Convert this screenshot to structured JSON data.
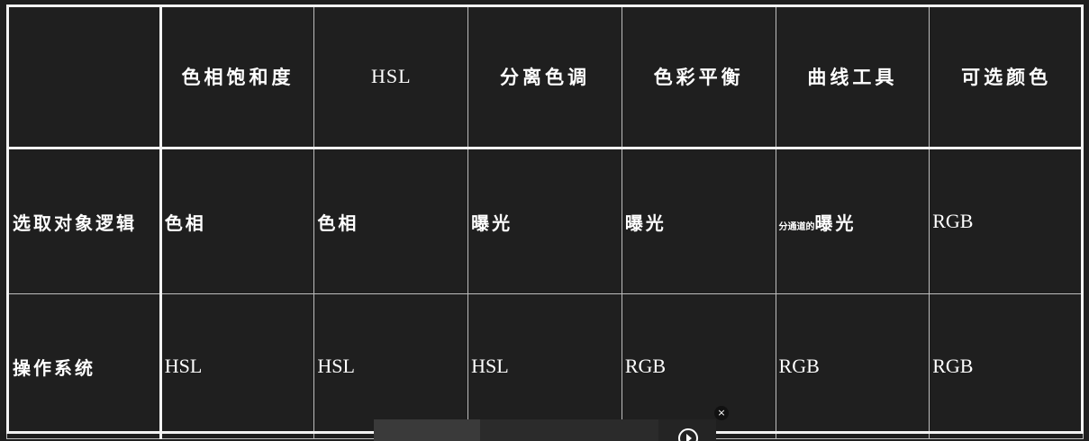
{
  "table": {
    "headers": [
      "",
      "色相饱和度",
      "HSL",
      "分离色调",
      "色彩平衡",
      "曲线工具",
      "可选颜色"
    ],
    "rows": [
      {
        "label": "选取对象逻辑",
        "cells": [
          {
            "text": "色相",
            "small_prefix": ""
          },
          {
            "text": "色相",
            "small_prefix": ""
          },
          {
            "text": "曝光",
            "small_prefix": ""
          },
          {
            "text": "曝光",
            "small_prefix": ""
          },
          {
            "text": "曝光",
            "small_prefix": "分通道的"
          },
          {
            "text": "RGB",
            "small_prefix": ""
          }
        ]
      },
      {
        "label": "操作系统",
        "cells": [
          {
            "text": "HSL",
            "small_prefix": ""
          },
          {
            "text": "HSL",
            "small_prefix": ""
          },
          {
            "text": "HSL",
            "small_prefix": ""
          },
          {
            "text": "RGB",
            "small_prefix": ""
          },
          {
            "text": "RGB",
            "small_prefix": ""
          },
          {
            "text": "RGB",
            "small_prefix": ""
          }
        ]
      }
    ]
  },
  "overlay": {
    "close_label": "×"
  },
  "colors": {
    "background": "#1f1f1f",
    "accent": "#f2a20c",
    "text": "#ffffff",
    "grid": "#bdbdbd"
  }
}
